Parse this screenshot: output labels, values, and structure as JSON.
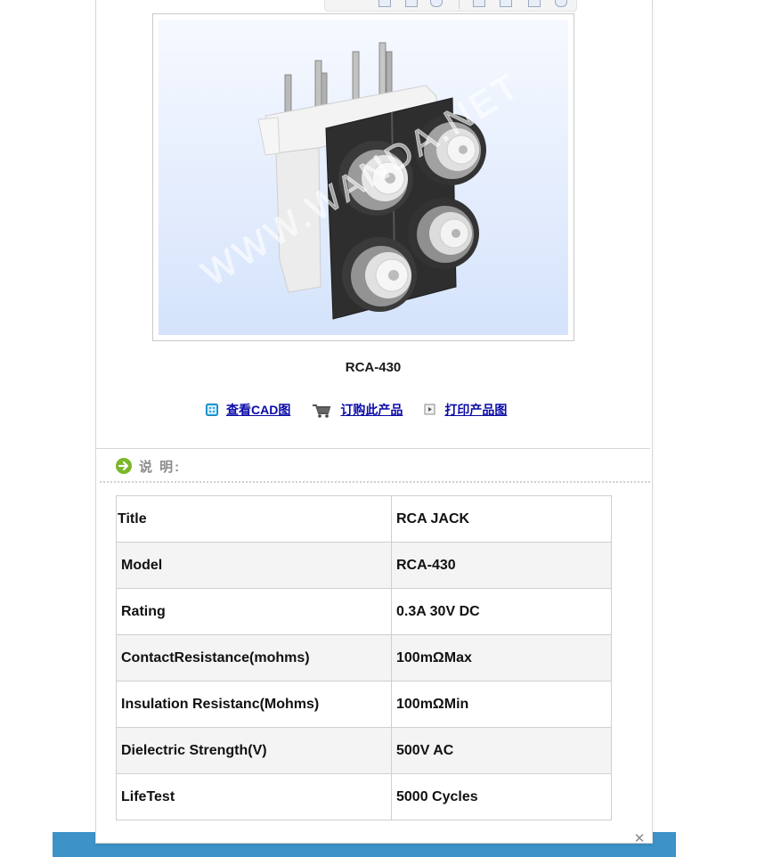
{
  "product": {
    "model": "RCA-430",
    "image_alt": "RCA-430 product photo",
    "watermark": "WWW.WANDA.NET"
  },
  "links": [
    {
      "icon": "cad-view-icon",
      "label": "查看CAD图"
    },
    {
      "icon": "cart-icon",
      "label": "订购此产品"
    },
    {
      "icon": "print-icon",
      "label": "打印产品图"
    }
  ],
  "section": {
    "title": "说 明:"
  },
  "specs": [
    {
      "key": "Title",
      "value": "RCA JACK"
    },
    {
      "key": "Model",
      "value": "RCA-430"
    },
    {
      "key": "Rating",
      "value": "0.3A 30V DC"
    },
    {
      "key": "ContactResistance(mohms)",
      "value": "100mΩMax"
    },
    {
      "key": "Insulation Resistanc(Mohms)",
      "value": "100mΩMin"
    },
    {
      "key": "Dielectric Strength(V)",
      "value": "500V AC"
    },
    {
      "key": "LifeTest",
      "value": "5000 Cycles"
    }
  ],
  "colors": {
    "link": "#0a0aa8",
    "bottom_bar": "#3d93c8",
    "section_arrow": "#7ab829"
  }
}
